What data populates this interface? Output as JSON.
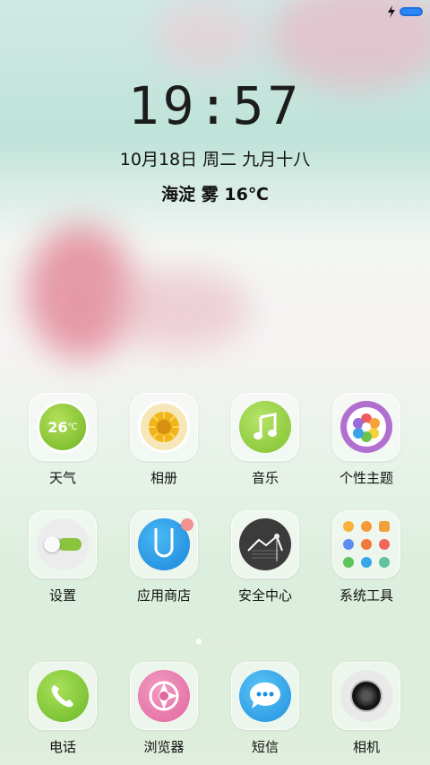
{
  "status": {
    "charging_icon": "bolt-icon",
    "battery_icon": "battery-icon",
    "battery_color": "#2a88f2"
  },
  "lockscreen": {
    "time": "19:57",
    "date_line": "10月18日  周二  九月十八",
    "weather_line": "海淀  雾  16℃"
  },
  "apps": [
    {
      "label": "天气",
      "icon": "weather-icon",
      "temp": "26"
    },
    {
      "label": "相册",
      "icon": "gallery-icon"
    },
    {
      "label": "音乐",
      "icon": "music-icon"
    },
    {
      "label": "个性主题",
      "icon": "theme-icon"
    },
    {
      "label": "设置",
      "icon": "settings-icon"
    },
    {
      "label": "应用商店",
      "icon": "app-store-icon"
    },
    {
      "label": "安全中心",
      "icon": "security-icon"
    },
    {
      "label": "系统工具",
      "icon": "system-tools-icon"
    }
  ],
  "page_indicator": {
    "pages": 3,
    "current": 1
  },
  "dock": [
    {
      "label": "电话",
      "icon": "phone-icon"
    },
    {
      "label": "浏览器",
      "icon": "browser-icon"
    },
    {
      "label": "短信",
      "icon": "messages-icon"
    },
    {
      "label": "相机",
      "icon": "camera-icon"
    }
  ]
}
